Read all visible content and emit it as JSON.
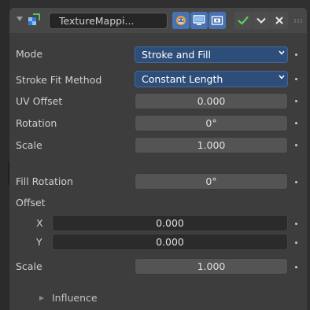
{
  "modifier": {
    "name": "TextureMappi..."
  },
  "mode": {
    "label": "Mode",
    "value": "Stroke and Fill"
  },
  "stroke_fit": {
    "label": "Stroke Fit Method",
    "value": "Constant Length"
  },
  "uv_offset": {
    "label": "UV Offset",
    "value": "0.000"
  },
  "rotation": {
    "label": "Rotation",
    "value": "0°"
  },
  "scale": {
    "label": "Scale",
    "value": "1.000"
  },
  "fill_rotation": {
    "label": "Fill Rotation",
    "value": "0°"
  },
  "offset": {
    "label": "Offset",
    "x_label": "X",
    "x_value": "0.000",
    "y_label": "Y",
    "y_value": "0.000"
  },
  "fill_scale": {
    "label": "Scale",
    "value": "1.000"
  },
  "influence": {
    "label": "Influence"
  },
  "colors": {
    "accent": "#4772b3",
    "dropdown": "#2e4e7a",
    "panel": "#3d3d3d",
    "field": "#545454"
  }
}
